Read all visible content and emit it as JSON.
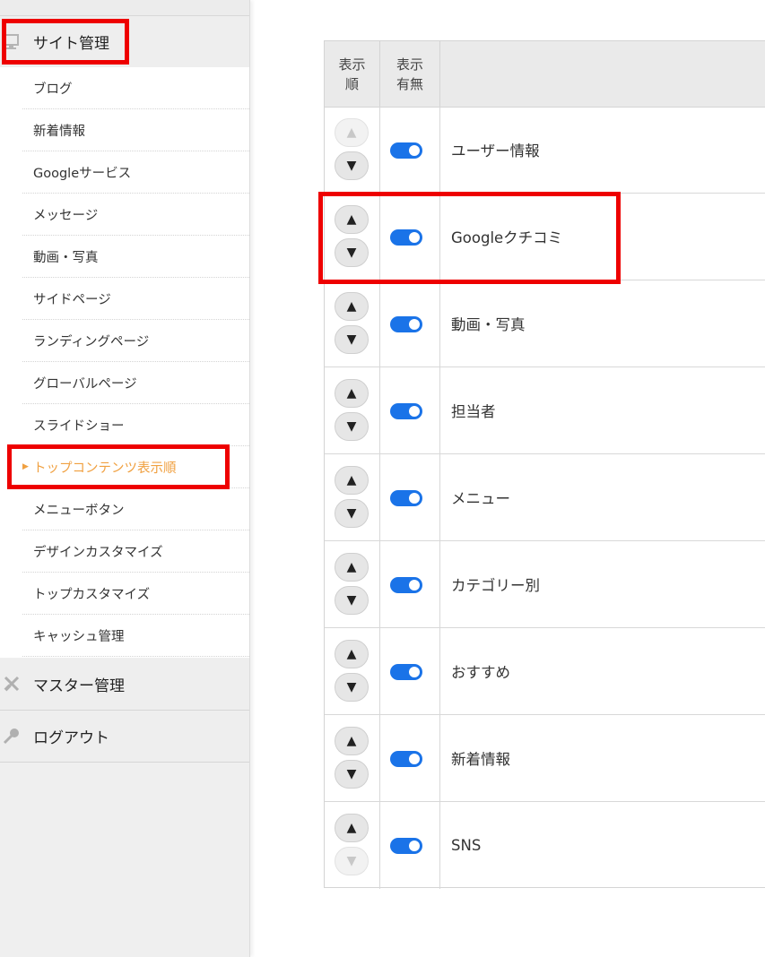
{
  "sidebar": {
    "site_section": {
      "label": "サイト管理",
      "icon": "monitor-icon"
    },
    "site_items": [
      {
        "label": "ブログ",
        "active": false
      },
      {
        "label": "新着情報",
        "active": false
      },
      {
        "label": "Googleサービス",
        "active": false
      },
      {
        "label": "メッセージ",
        "active": false
      },
      {
        "label": "動画・写真",
        "active": false
      },
      {
        "label": "サイドページ",
        "active": false
      },
      {
        "label": "ランディングページ",
        "active": false
      },
      {
        "label": "グローバルページ",
        "active": false
      },
      {
        "label": "スライドショー",
        "active": false
      },
      {
        "label": "トップコンテンツ表示順",
        "active": true
      },
      {
        "label": "メニューボタン",
        "active": false
      },
      {
        "label": "デザインカスタマイズ",
        "active": false
      },
      {
        "label": "トップカスタマイズ",
        "active": false
      },
      {
        "label": "キャッシュ管理",
        "active": false
      }
    ],
    "master_section": {
      "label": "マスター管理",
      "icon": "tools-icon"
    },
    "logout_section": {
      "label": "ログアウト",
      "icon": "key-icon"
    }
  },
  "table": {
    "col_order": "表示\n順",
    "col_visible": "表示\n有無",
    "rows": [
      {
        "name": "ユーザー情報",
        "visible": true,
        "up_enabled": false,
        "down_enabled": true
      },
      {
        "name": "Googleクチコミ",
        "visible": true,
        "up_enabled": true,
        "down_enabled": true
      },
      {
        "name": "動画・写真",
        "visible": true,
        "up_enabled": true,
        "down_enabled": true
      },
      {
        "name": "担当者",
        "visible": true,
        "up_enabled": true,
        "down_enabled": true
      },
      {
        "name": "メニュー",
        "visible": true,
        "up_enabled": true,
        "down_enabled": true
      },
      {
        "name": "カテゴリー別",
        "visible": true,
        "up_enabled": true,
        "down_enabled": true
      },
      {
        "name": "おすすめ",
        "visible": true,
        "up_enabled": true,
        "down_enabled": true
      },
      {
        "name": "新着情報",
        "visible": true,
        "up_enabled": true,
        "down_enabled": true
      },
      {
        "name": "SNS",
        "visible": true,
        "up_enabled": true,
        "down_enabled": false
      }
    ]
  },
  "colors": {
    "accent": "#1a73e8",
    "active_menu": "#f0a040",
    "highlight_box": "#ee0000"
  }
}
